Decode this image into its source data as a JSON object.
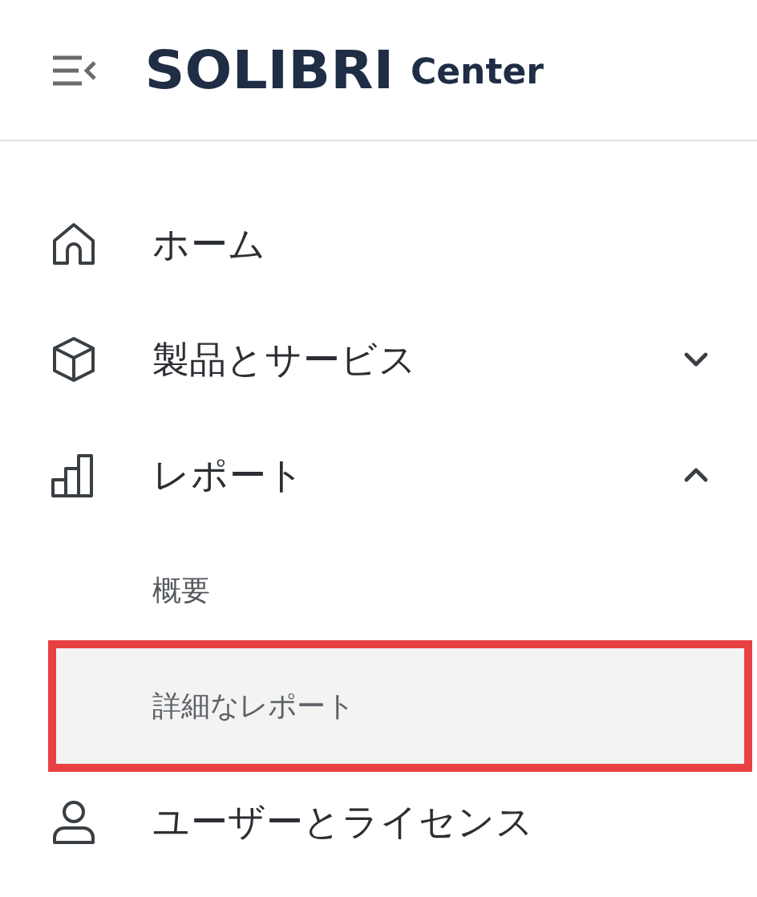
{
  "header": {
    "logo": "SOLIBRI",
    "product": "Center"
  },
  "nav": [
    {
      "label": "ホーム"
    },
    {
      "label": "製品とサービス",
      "expanded": false
    },
    {
      "label": "レポート",
      "expanded": true,
      "children": [
        {
          "label": "概要",
          "selected": false,
          "highlighted": false
        },
        {
          "label": "詳細なレポート",
          "selected": true,
          "highlighted": true
        }
      ]
    },
    {
      "label": "ユーザーとライセンス"
    }
  ]
}
